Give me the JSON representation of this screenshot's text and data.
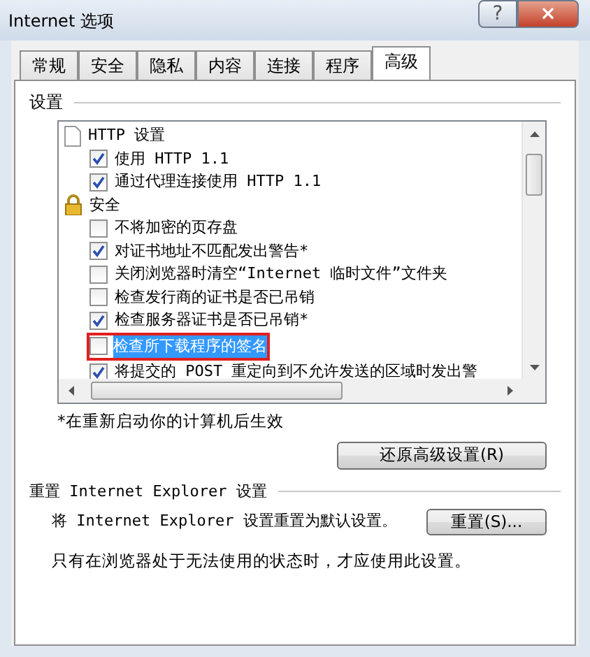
{
  "window": {
    "title": "Internet 选项",
    "help_button": "?",
    "close_button": "×"
  },
  "tabs": [
    {
      "label": "常规",
      "selected": false
    },
    {
      "label": "安全",
      "selected": false
    },
    {
      "label": "隐私",
      "selected": false
    },
    {
      "label": "内容",
      "selected": false
    },
    {
      "label": "连接",
      "selected": false
    },
    {
      "label": "程序",
      "selected": false
    },
    {
      "label": "高级",
      "selected": true
    }
  ],
  "settings": {
    "title": "设置",
    "items": [
      {
        "kind": "group",
        "label": "HTTP 设置",
        "children": [
          {
            "kind": "checkbox",
            "label": "使用 HTTP 1.1",
            "checked": true,
            "selected": false
          },
          {
            "kind": "checkbox",
            "label": "通过代理连接使用 HTTP 1.1",
            "checked": true,
            "selected": false
          }
        ]
      },
      {
        "kind": "group",
        "label": "安全",
        "children": [
          {
            "kind": "checkbox",
            "label": "不将加密的页存盘",
            "checked": false,
            "selected": false
          },
          {
            "kind": "checkbox",
            "label": "对证书地址不匹配发出警告*",
            "checked": true,
            "selected": false
          },
          {
            "kind": "checkbox",
            "label": "关闭浏览器时清空“Internet 临时文件”文件夹",
            "checked": false,
            "selected": false
          },
          {
            "kind": "checkbox",
            "label": "检查发行商的证书是否已吊销",
            "checked": false,
            "selected": false
          },
          {
            "kind": "checkbox",
            "label": "检查服务器证书是否已吊销*",
            "checked": true,
            "selected": false
          },
          {
            "kind": "checkbox",
            "label": "检查所下载程序的签名",
            "checked": false,
            "selected": true,
            "highlighted": true
          },
          {
            "kind": "checkbox",
            "label": "将提交的 POST 重定向到不允许发送的区域时发出警",
            "checked": true,
            "selected": false
          }
        ]
      }
    ]
  },
  "footnote": "*在重新启动你的计算机后生效",
  "restore_button": "还原高级设置(R)",
  "reset_group": {
    "title": "重置 Internet Explorer 设置",
    "description": "将 Internet Explorer 设置重置为默认设置。",
    "button": "重置(S)...",
    "note": "只有在浏览器处于无法使用的状态时，才应使用此设置。"
  }
}
